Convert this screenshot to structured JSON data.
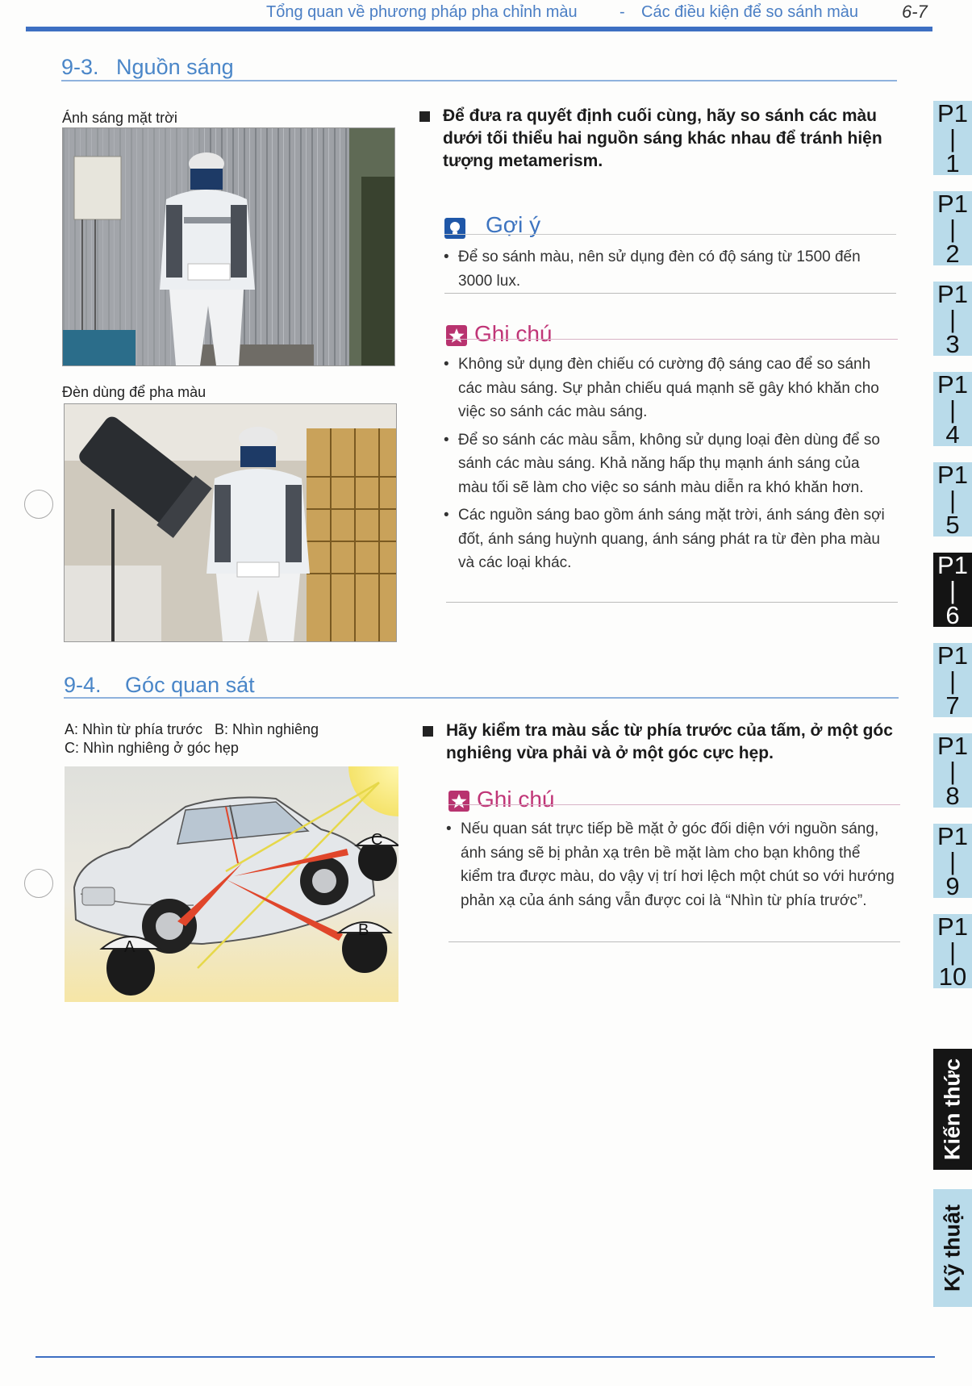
{
  "header": {
    "title_left": "Tổng quan về phương pháp pha chỉnh màu",
    "separator": "-",
    "title_right": "Các điều kiện để so sánh màu",
    "page_number": "6-7"
  },
  "section_93": {
    "number": "9-3.",
    "title": "Nguồn sáng",
    "photo1_caption": "Ánh sáng mặt trời",
    "photo2_caption": "Đèn dùng để pha màu",
    "lead": "Để đưa ra quyết định cuối cùng, hãy so sánh các màu dưới tối thiểu hai nguồn sáng khác nhau để tránh hiện tượng metamerism.",
    "hint": {
      "title": "Gợi ý",
      "items": [
        "Để so sánh màu, nên sử dụng đèn có độ sáng từ 1500 đến 3000 lux."
      ]
    },
    "note": {
      "title": "Ghi chú",
      "items": [
        "Không sử dụng đèn chiếu có cường độ sáng cao để so sánh các màu sáng. Sự phản chiếu quá mạnh sẽ gây khó khăn cho việc so sánh các màu sáng.",
        "Để so sánh các màu sẫm, không sử dụng loại đèn dùng để so sánh các màu sáng. Khả năng hấp thụ mạnh ánh sáng của màu tối sẽ làm cho việc so sánh màu diễn ra khó khăn hơn.",
        "Các nguồn sáng bao gồm ánh sáng mặt trời, ánh sáng đèn sợi đốt, ánh sáng huỳnh quang, ánh sáng phát ra từ đèn pha màu và các loại khác."
      ]
    }
  },
  "section_94": {
    "number": "9-4.",
    "title": "Góc quan sát",
    "caption_line1": "A: Nhìn từ phía trước   B: Nhìn nghiêng",
    "caption_line2": "C: Nhìn nghiêng ở góc hẹp",
    "viewer_labels": [
      "A",
      "B",
      "C"
    ],
    "lead": "Hãy kiểm tra màu sắc từ phía trước của tấm, ở một góc nghiêng vừa phải và ở một góc cực hẹp.",
    "note": {
      "title": "Ghi chú",
      "items": [
        "Nếu quan sát trực tiếp bề mặt ở góc đối diện với nguồn sáng, ánh sáng sẽ bị phản xạ trên bề mặt làm cho bạn không thể kiểm tra được màu, do vậy vị trí hơi lệch một chút so với hướng phản xạ của ánh sáng vẫn được coi là “Nhìn từ phía trước”."
      ]
    }
  },
  "side_tabs": [
    {
      "top": "P1",
      "bar": "|",
      "num": "1",
      "active": false
    },
    {
      "top": "P1",
      "bar": "|",
      "num": "2",
      "active": false
    },
    {
      "top": "P1",
      "bar": "|",
      "num": "3",
      "active": false
    },
    {
      "top": "P1",
      "bar": "|",
      "num": "4",
      "active": false
    },
    {
      "top": "P1",
      "bar": "|",
      "num": "5",
      "active": false
    },
    {
      "top": "P1",
      "bar": "|",
      "num": "6",
      "active": true
    },
    {
      "top": "P1",
      "bar": "|",
      "num": "7",
      "active": false
    },
    {
      "top": "P1",
      "bar": "|",
      "num": "8",
      "active": false
    },
    {
      "top": "P1",
      "bar": "|",
      "num": "9",
      "active": false
    },
    {
      "top": "P1",
      "bar": "|",
      "num": "10",
      "active": false
    }
  ],
  "vertical_tabs": {
    "knowledge": "Kiến thức",
    "technique": "Kỹ thuật"
  },
  "colors": {
    "accent_blue": "#3d6fc2",
    "tab_light": "#b9dbea",
    "note_pink": "#c03577"
  }
}
